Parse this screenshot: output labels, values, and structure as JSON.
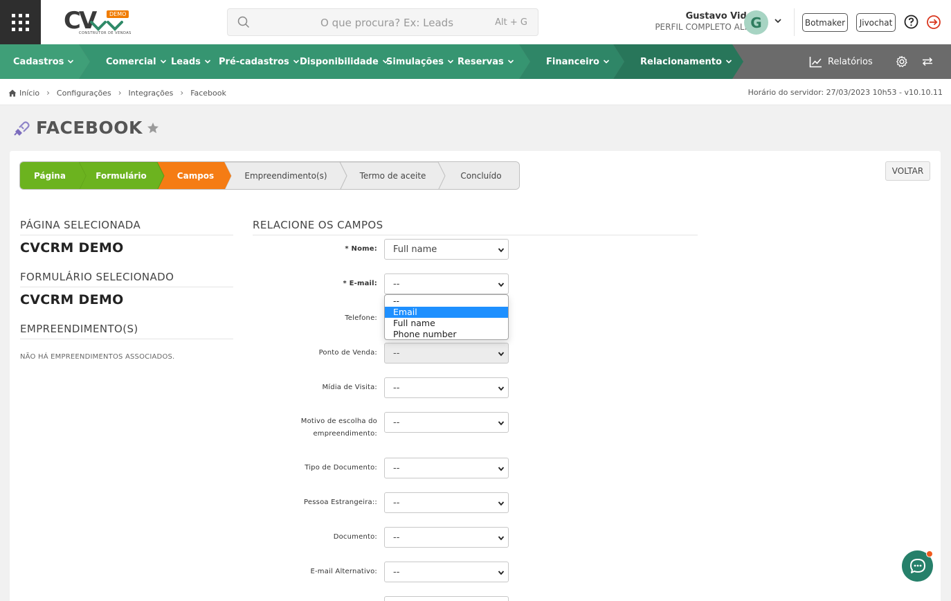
{
  "logo": {
    "text": "CV",
    "badge": "DEMO",
    "subtitle": "CONSTRUTOR DE VENDAS"
  },
  "search": {
    "placeholder": "O que procura? Ex: Leads",
    "shortcut": "Alt + G"
  },
  "user": {
    "name": "Gustavo Vidal",
    "profile": "PERFIL COMPLETO ALF...",
    "initial": "G"
  },
  "header_buttons": {
    "botmaker": "Botmaker",
    "jivochat": "Jivochat"
  },
  "nav": {
    "items": [
      {
        "label": "Cadastros"
      },
      {
        "label": "Comercial"
      },
      {
        "label": "Leads"
      },
      {
        "label": "Pré-cadastros"
      },
      {
        "label": "Disponibilidade"
      },
      {
        "label": "Simulações"
      },
      {
        "label": "Reservas"
      },
      {
        "label": "Financeiro"
      },
      {
        "label": "Relacionamento"
      }
    ],
    "reports": "Relatórios",
    "colors": {
      "green_light": "#3f9f78",
      "green_mid": "#369571",
      "green_dark": "#2f8667",
      "green_darker": "#28765a",
      "gray": "#6b6b6b"
    }
  },
  "breadcrumb": {
    "items": [
      "Início",
      "Configurações",
      "Integrações",
      "Facebook"
    ],
    "server_time": "Horário do servidor: 27/03/2023 10h53 - v10.10.11"
  },
  "page": {
    "title": "FACEBOOK"
  },
  "steps": {
    "items": [
      {
        "label": "Página",
        "state": "done"
      },
      {
        "label": "Formulário",
        "state": "done"
      },
      {
        "label": "Campos",
        "state": "current"
      },
      {
        "label": "Empreendimento(s)",
        "state": "todo"
      },
      {
        "label": "Termo de aceite",
        "state": "todo"
      },
      {
        "label": "Concluído",
        "state": "todo"
      }
    ],
    "colors": {
      "done": "#6cb31f",
      "current": "#f57c14",
      "todo": "#ececec"
    }
  },
  "back_button": "VOLTAR",
  "summary": {
    "page_heading": "PÁGINA SELECIONADA",
    "page_value": "CVCRM DEMO",
    "form_heading": "FORMULÁRIO SELECIONADO",
    "form_value": "CVCRM DEMO",
    "dev_heading": "EMPREENDIMENTO(S)",
    "dev_note": "NÃO HÁ EMPREENDIMENTOS ASSOCIADOS."
  },
  "fields": {
    "heading": "RELACIONE OS CAMPOS",
    "nome": {
      "required": "* ",
      "label": "Nome:",
      "value": "Full name"
    },
    "email": {
      "required": "* ",
      "label": "E-mail:",
      "value": "--"
    },
    "telefone": {
      "label": "Telefone:"
    },
    "ponto_venda": {
      "label": "Ponto de Venda:",
      "value": "--"
    },
    "midia": {
      "label": "Mídia de Visita:",
      "value": "--"
    },
    "motivo": {
      "label_line1": "Motivo de escolha do",
      "label_line2": "empreendimento:",
      "value": "--"
    },
    "tipo_doc": {
      "label": "Tipo de Documento:",
      "value": "--"
    },
    "estrangeira": {
      "label": "Pessoa Estrangeira::",
      "value": "--"
    },
    "documento": {
      "label": "Documento:",
      "value": "--"
    },
    "email_alt": {
      "label": "E-mail Alternativo:",
      "value": "--"
    }
  },
  "email_dropdown": {
    "options": [
      "--",
      "Email",
      "Full name",
      "Phone number"
    ],
    "highlighted": "Email"
  }
}
